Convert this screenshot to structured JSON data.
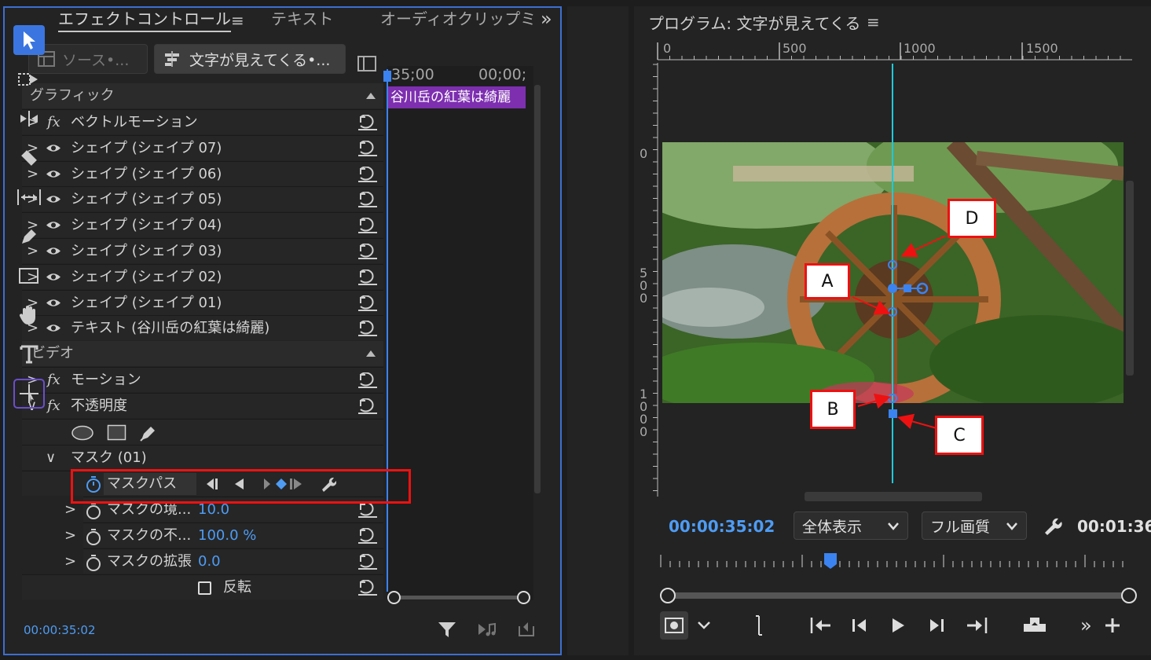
{
  "tabs": {
    "effect_controls": "エフェクトコントロール",
    "text": "テキスト",
    "audio_clip": "オーディオクリップミ",
    "menu": "≡",
    "overflow": "»"
  },
  "source": {
    "source_label": "ソース•...",
    "sequence_label": "文字が見えてくる•..."
  },
  "timeline": {
    "ts1": "35;00",
    "ts2": "00;00;",
    "clip_label": "谷川岳の紅葉は綺麗"
  },
  "sections": {
    "graphics": "グラフィック",
    "video": "ビデオ"
  },
  "graphic_rows": [
    {
      "label": "ベクトルモーション",
      "kind": "fx"
    },
    {
      "label": "シェイプ (シェイプ 07)",
      "kind": "eye"
    },
    {
      "label": "シェイプ (シェイプ 06)",
      "kind": "eye"
    },
    {
      "label": "シェイプ (シェイプ 05)",
      "kind": "eye"
    },
    {
      "label": "シェイプ (シェイプ 04)",
      "kind": "eye"
    },
    {
      "label": "シェイプ (シェイプ 03)",
      "kind": "eye"
    },
    {
      "label": "シェイプ (シェイプ 02)",
      "kind": "eye"
    },
    {
      "label": "シェイプ (シェイプ 01)",
      "kind": "eye"
    },
    {
      "label": "テキスト (谷川岳の紅葉は綺麗)",
      "kind": "eye"
    }
  ],
  "video_rows": {
    "motion": "モーション",
    "opacity": "不透明度",
    "mask": "マスク (01)",
    "mask_path": "マスクパス",
    "mask_feather_label": "マスクの境...",
    "mask_feather_value": "10.0",
    "mask_opacity_label": "マスクの不...",
    "mask_opacity_value": "100.0 %",
    "mask_expand_label": "マスクの拡張",
    "mask_expand_value": "0.0",
    "invert": "反転"
  },
  "left_footer": {
    "timecode": "00:00:35:02"
  },
  "monitor": {
    "title": "プログラム: 文字が見えてくる",
    "menu": "≡",
    "ruler_h": [
      "0",
      "500",
      "1000",
      "1500"
    ],
    "ruler_v_0": "0",
    "ruler_v_500": [
      "5",
      "0",
      "0"
    ],
    "ruler_v_1000": [
      "1",
      "0",
      "0",
      "0"
    ],
    "timecode_current": "00:00:35:02",
    "zoom": "全体表示",
    "quality": "フル画質",
    "timecode_total": "00:01:36:"
  },
  "callouts": {
    "a": "A",
    "b": "B",
    "c": "C",
    "d": "D"
  },
  "colors": {
    "accent_blue": "#3b83f0",
    "highlight_red": "#ee1111",
    "clip_purple": "#7d2fb0",
    "mask_cyan": "#20c9d9"
  }
}
